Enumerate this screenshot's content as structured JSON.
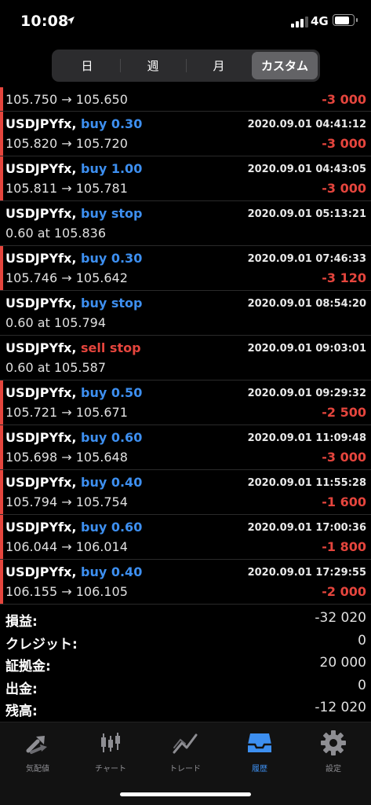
{
  "status_bar": {
    "time": "10:08",
    "network": "4G"
  },
  "period_tabs": [
    {
      "label": "日",
      "active": false
    },
    {
      "label": "週",
      "active": false
    },
    {
      "label": "月",
      "active": false
    },
    {
      "label": "カスタム",
      "active": true
    }
  ],
  "partial_row": {
    "prices": "105.750 → 105.650",
    "profit": "-3 000"
  },
  "trades": [
    {
      "symbol": "USDJPYfx,",
      "order": "buy 0.30",
      "side": "buy",
      "time": "2020.09.01 04:41:12",
      "prices": "105.820 → 105.720",
      "profit": "-3 000",
      "closed": true
    },
    {
      "symbol": "USDJPYfx,",
      "order": "buy 1.00",
      "side": "buy",
      "time": "2020.09.01 04:43:05",
      "prices": "105.811 → 105.781",
      "profit": "-3 000",
      "closed": true
    },
    {
      "symbol": "USDJPYfx,",
      "order": "buy stop",
      "side": "buy",
      "time": "2020.09.01 05:13:21",
      "prices": "0.60 at 105.836",
      "profit": "",
      "closed": false
    },
    {
      "symbol": "USDJPYfx,",
      "order": "buy 0.30",
      "side": "buy",
      "time": "2020.09.01 07:46:33",
      "prices": "105.746 → 105.642",
      "profit": "-3 120",
      "closed": true
    },
    {
      "symbol": "USDJPYfx,",
      "order": "buy stop",
      "side": "buy",
      "time": "2020.09.01 08:54:20",
      "prices": "0.60 at 105.794",
      "profit": "",
      "closed": false
    },
    {
      "symbol": "USDJPYfx,",
      "order": "sell stop",
      "side": "sell",
      "time": "2020.09.01 09:03:01",
      "prices": "0.60 at 105.587",
      "profit": "",
      "closed": false
    },
    {
      "symbol": "USDJPYfx,",
      "order": "buy 0.50",
      "side": "buy",
      "time": "2020.09.01 09:29:32",
      "prices": "105.721 → 105.671",
      "profit": "-2 500",
      "closed": true
    },
    {
      "symbol": "USDJPYfx,",
      "order": "buy 0.60",
      "side": "buy",
      "time": "2020.09.01 11:09:48",
      "prices": "105.698 → 105.648",
      "profit": "-3 000",
      "closed": true
    },
    {
      "symbol": "USDJPYfx,",
      "order": "buy 0.40",
      "side": "buy",
      "time": "2020.09.01 11:55:28",
      "prices": "105.794 → 105.754",
      "profit": "-1 600",
      "closed": true
    },
    {
      "symbol": "USDJPYfx,",
      "order": "buy 0.60",
      "side": "buy",
      "time": "2020.09.01 17:00:36",
      "prices": "106.044 → 106.014",
      "profit": "-1 800",
      "closed": true
    },
    {
      "symbol": "USDJPYfx,",
      "order": "buy 0.40",
      "side": "buy",
      "time": "2020.09.01 17:29:55",
      "prices": "106.155 → 106.105",
      "profit": "-2 000",
      "closed": true
    }
  ],
  "summary": [
    {
      "label": "損益:",
      "value": "-32 020"
    },
    {
      "label": "クレジット:",
      "value": "0"
    },
    {
      "label": "証拠金:",
      "value": "20 000"
    },
    {
      "label": "出金:",
      "value": "0"
    },
    {
      "label": "残高:",
      "value": "-12 020"
    }
  ],
  "tabbar": [
    {
      "label": "気配値",
      "icon": "quotes-arrows-icon",
      "active": false
    },
    {
      "label": "チャート",
      "icon": "candlestick-chart-icon",
      "active": false
    },
    {
      "label": "トレード",
      "icon": "trade-chart-icon",
      "active": false
    },
    {
      "label": "履歴",
      "icon": "history-tray-icon",
      "active": true
    },
    {
      "label": "設定",
      "icon": "gear-icon",
      "active": false
    }
  ],
  "colors": {
    "loss": "#e5453d",
    "buy": "#3d8ff0",
    "sell": "#e5453d",
    "active_tab": "#3d8ff0",
    "inactive_tab": "#8e8e93"
  },
  "battery_level": 0.85,
  "signal_bars": 3
}
